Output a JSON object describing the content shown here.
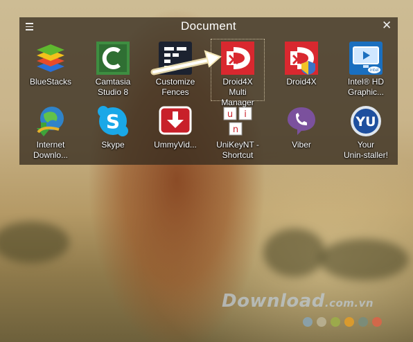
{
  "fence": {
    "title": "Document",
    "items": [
      {
        "label": "BlueStacks",
        "icon": "bluestacks-icon"
      },
      {
        "label": "Camtasia\nStudio 8",
        "icon": "camtasia-icon"
      },
      {
        "label": "Customize\nFences",
        "icon": "fences-icon"
      },
      {
        "label": "Droid4X\nMulti\nManager",
        "icon": "droid4x-icon"
      },
      {
        "label": "Droid4X",
        "icon": "droid4x-icon"
      },
      {
        "label": "Intel® HD\nGraphic...",
        "icon": "intel-graphics-icon"
      },
      {
        "label": "Internet\nDownlo...",
        "icon": "internet-download-manager-icon"
      },
      {
        "label": "Skype",
        "icon": "skype-icon"
      },
      {
        "label": "UmmyVid...",
        "icon": "ummy-video-icon"
      },
      {
        "label": "UniKeyNT -\nShortcut",
        "icon": "unikey-icon"
      },
      {
        "label": "Viber",
        "icon": "viber-icon"
      },
      {
        "label": "Your\nUnin-staller!",
        "icon": "your-uninstaller-icon"
      }
    ]
  },
  "watermark": {
    "brand": "Download",
    "suffix": ".com.vn"
  },
  "colors": {
    "fence_bg": "#372d20",
    "dots": [
      "#8aa0a8",
      "#b6ad8e",
      "#9ca94b",
      "#d99a2e",
      "#7b8c79",
      "#d2684a"
    ]
  }
}
